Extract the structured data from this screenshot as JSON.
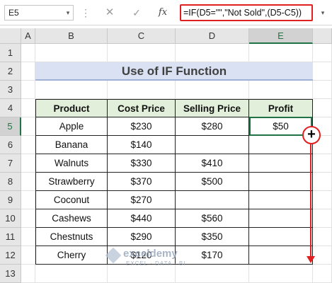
{
  "formula_bar": {
    "name_box": "E5",
    "name_box_arrow": "▾",
    "dots": "⋮",
    "cancel_icon": "✕",
    "enter_icon": "✓",
    "fx_label": "fx",
    "formula": "=IF(D5=\"\",\"Not Sold\",(D5-C5))",
    "expand_icon": "▾"
  },
  "columns": [
    "A",
    "B",
    "C",
    "D",
    "E"
  ],
  "rows": [
    "1",
    "2",
    "3",
    "4",
    "5",
    "6",
    "7",
    "8",
    "9",
    "10",
    "11",
    "12",
    "13"
  ],
  "title": "Use of IF Function",
  "table": {
    "headers": [
      "Product",
      "Cost Price",
      "Selling Price",
      "Profit"
    ],
    "rows": [
      [
        "Apple",
        "$230",
        "$280",
        "$50"
      ],
      [
        "Banana",
        "$140",
        "",
        ""
      ],
      [
        "Walnuts",
        "$330",
        "$410",
        ""
      ],
      [
        "Strawberry",
        "$370",
        "$500",
        ""
      ],
      [
        "Coconut",
        "$270",
        "",
        ""
      ],
      [
        "Cashews",
        "$440",
        "$560",
        ""
      ],
      [
        "Chestnuts",
        "$290",
        "$350",
        ""
      ],
      [
        "Cherry",
        "$120",
        "$170",
        ""
      ]
    ]
  },
  "annotation": {
    "fill_cursor": "+"
  },
  "watermark": {
    "name": "exceldemy",
    "tagline": "EXCEL · DATA · BI"
  },
  "colors": {
    "accent": "#217346",
    "highlight": "#e02020",
    "header_fill": "#e2efda",
    "title_fill": "#d9e1f2"
  }
}
